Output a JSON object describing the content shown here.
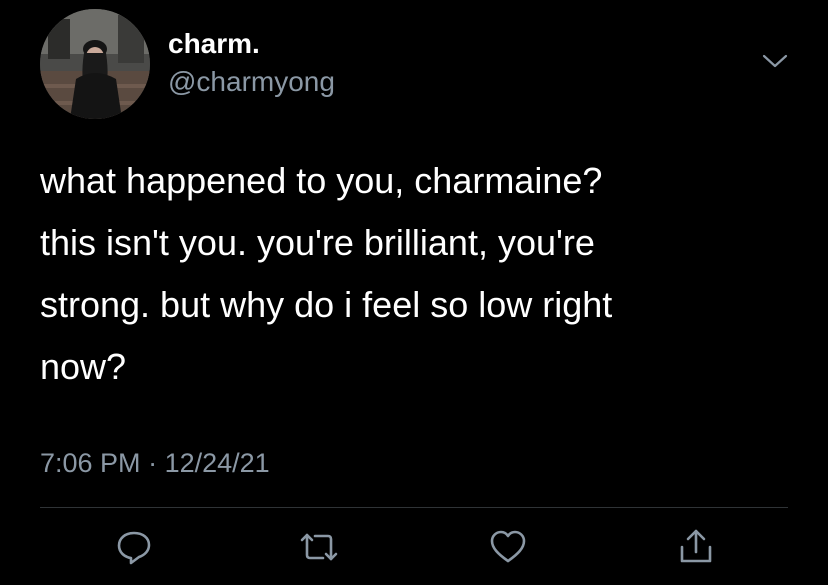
{
  "author": {
    "display_name": "charm.",
    "handle": "@charmyong",
    "avatar_icon": "profile-photo"
  },
  "tweet": {
    "lines": [
      "what happened to you, charmaine?",
      "this isn't you. you're brilliant, you're",
      "strong. but why do i feel so low right",
      "now?"
    ],
    "time": "7:06 PM",
    "separator": "·",
    "date": "12/24/21"
  },
  "actions": {
    "reply_icon": "reply-icon",
    "retweet_icon": "retweet-icon",
    "like_icon": "heart-icon",
    "share_icon": "share-icon"
  },
  "colors": {
    "background": "#000000",
    "primary_text": "#ffffff",
    "secondary_text": "#8b98a5",
    "icon": "#8b98a5",
    "divider": "#2f3336"
  }
}
